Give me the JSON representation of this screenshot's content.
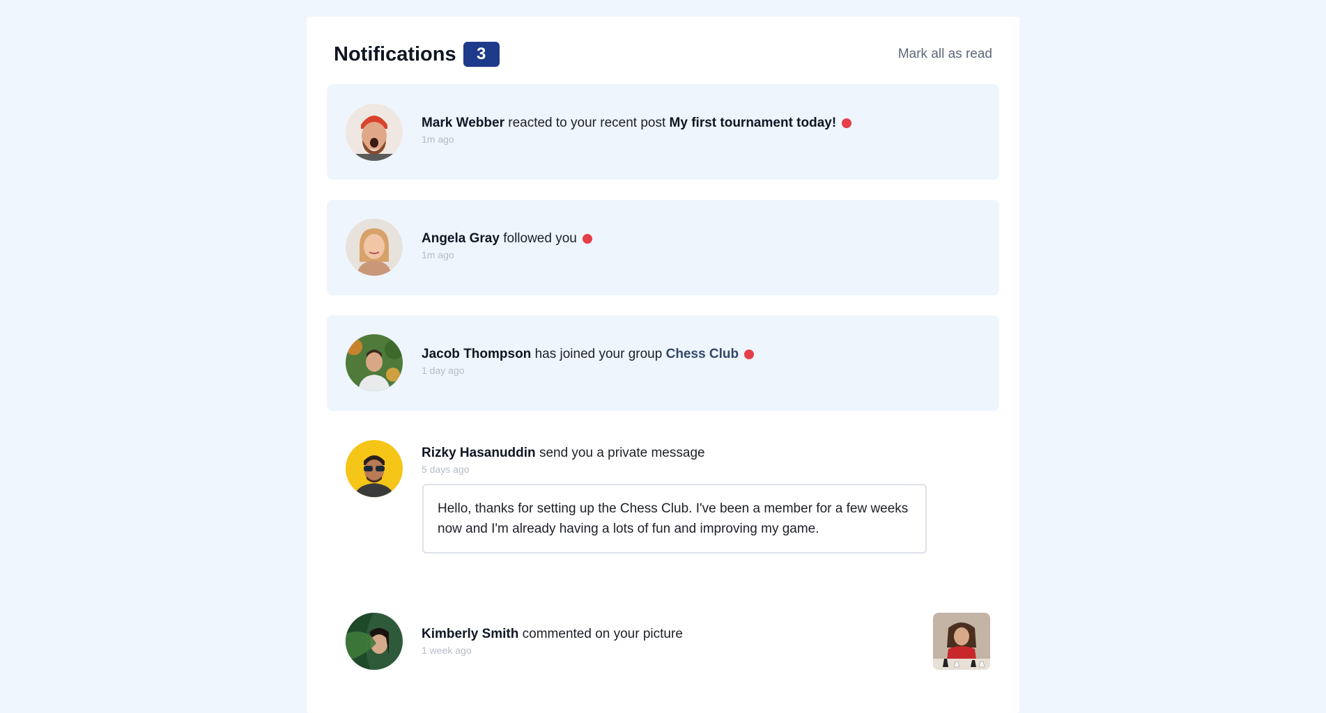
{
  "header": {
    "title": "Notifications",
    "unread_count": "3",
    "mark_all_label": "Mark all as read"
  },
  "notifications": [
    {
      "name": "Mark Webber",
      "action": "reacted to your recent post",
      "target": "My first tournament today!",
      "time": "1m ago",
      "unread": true
    },
    {
      "name": "Angela Gray",
      "action": "followed you",
      "time": "1m ago",
      "unread": true
    },
    {
      "name": "Jacob Thompson",
      "action": "has joined your group",
      "target": "Chess Club",
      "time": "1 day ago",
      "unread": true
    },
    {
      "name": "Rizky Hasanuddin",
      "action": "send you a private message",
      "time": "5 days ago",
      "unread": false,
      "message": "Hello, thanks for setting up the Chess Club. I've been a member for a few weeks now and I'm already having a lots of fun and improving my game."
    },
    {
      "name": "Kimberly Smith",
      "action": "commented on your picture",
      "time": "1 week ago",
      "unread": false
    }
  ],
  "colors": {
    "page_bg": "#f0f6fd",
    "unread_bg": "#eef5fd",
    "badge": "#1e3a8a",
    "unread_dot": "#e5404a",
    "group_link": "#34466a"
  },
  "icons": {
    "unread_indicator": "red-dot",
    "avatars": [
      "avatar-mark-webber",
      "avatar-angela-gray",
      "avatar-jacob-thompson",
      "avatar-rizky-hasanuddin",
      "avatar-kimberly-smith"
    ],
    "comment_picture": "chess-picture-thumbnail"
  }
}
